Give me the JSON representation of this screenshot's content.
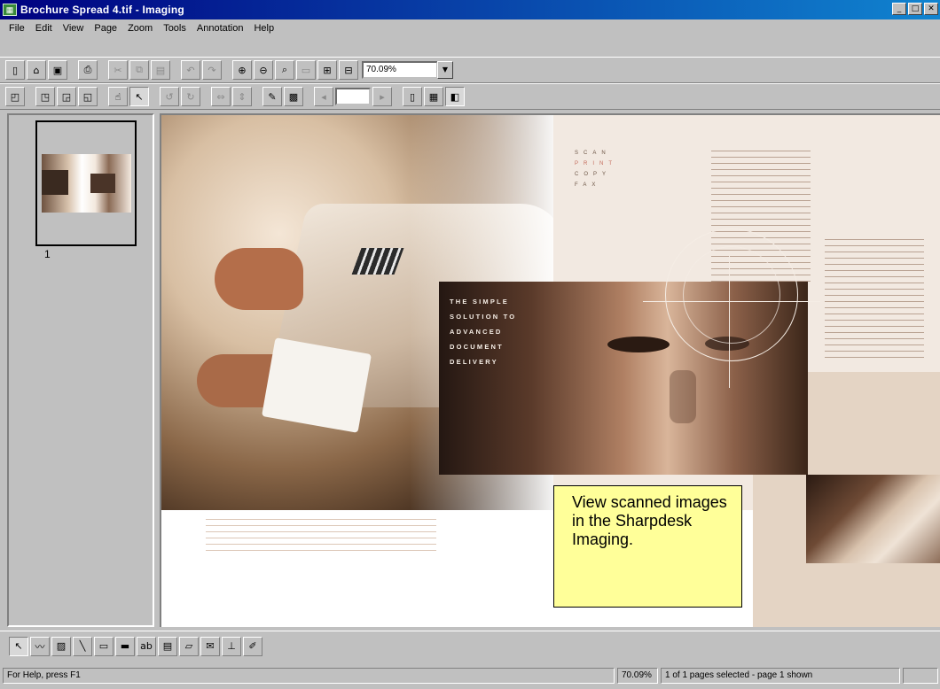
{
  "window": {
    "title": "Brochure Spread 4.tif - Imaging",
    "minimize": "_",
    "maximize": "□",
    "close": "✕"
  },
  "menu": [
    "File",
    "Edit",
    "View",
    "Page",
    "Zoom",
    "Tools",
    "Annotation",
    "Help"
  ],
  "toolbar": {
    "zoom_value": "70.09%",
    "zoom_dropdown": "▼"
  },
  "thumbnail": {
    "page_number": "1"
  },
  "document": {
    "stacked_words": [
      "SCAN",
      "PRINT",
      "COPY",
      "FAX"
    ],
    "headline": "THE SIMPLE\nSOLUTION TO\nADVANCED\nDOCUMENT\nDELIVERY"
  },
  "callout": {
    "text": "View scanned images in the Sharpdesk Imaging."
  },
  "status": {
    "help": "For Help, press F1",
    "zoom": "70.09%",
    "pages": "1 of 1 pages selected - page 1 shown"
  },
  "icons": {
    "new": "□",
    "open": "📂",
    "save": "💾",
    "print": "🖶",
    "zoom_in": "🔍",
    "pointer": "↖",
    "hand": "✋"
  }
}
